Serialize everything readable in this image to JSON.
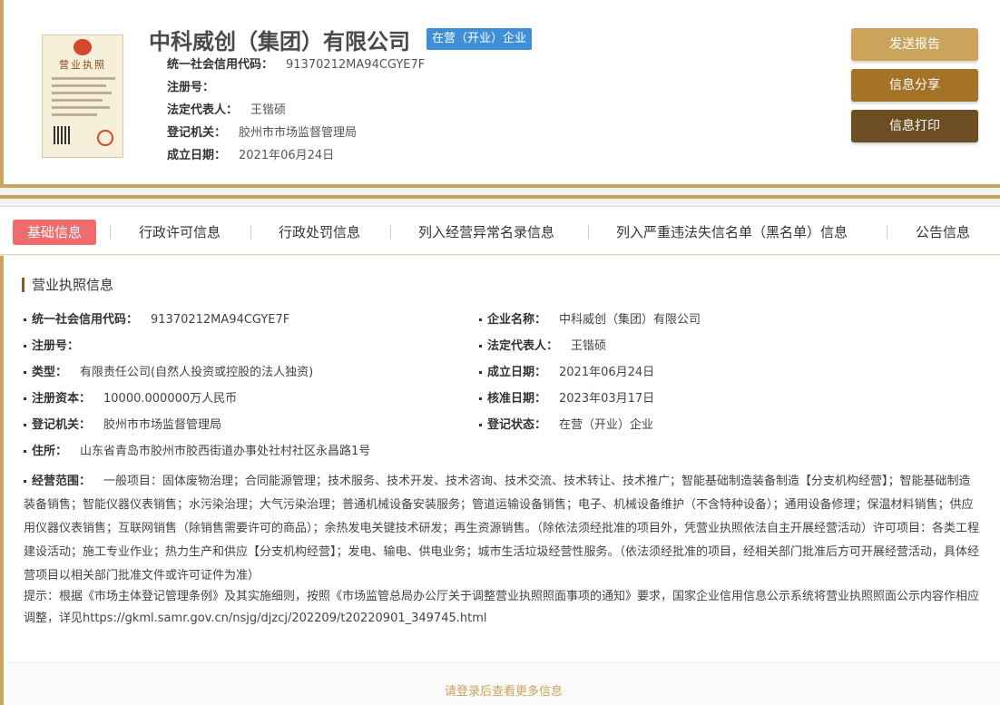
{
  "header": {
    "company_name": "中科威创（集团）有限公司",
    "status": "在营（开业）企业",
    "info": [
      {
        "label": "统一社会信用代码：",
        "value": "91370212MA94CGYE7F"
      },
      {
        "label": "注册号：",
        "value": ""
      },
      {
        "label": "法定代表人：",
        "value": "王锴硕"
      },
      {
        "label": "登记机关：",
        "value": "胶州市市场监督管理局"
      },
      {
        "label": "成立日期：",
        "value": "2021年06月24日"
      }
    ],
    "license": {
      "title": "营业执照"
    },
    "buttons": {
      "send": "发送报告",
      "share": "信息分享",
      "print": "信息打印"
    }
  },
  "tabs": [
    "基础信息",
    "行政许可信息",
    "行政处罚信息",
    "列入经营异常名录信息",
    "列入严重违法失信名单（黑名单）信息",
    "公告信息"
  ],
  "section": {
    "title": "营业执照信息"
  },
  "fields": {
    "credit_code": {
      "label": "统一社会信用代码：",
      "value": "91370212MA94CGYE7F"
    },
    "company_name": {
      "label": "企业名称：",
      "value": "中科威创（集团）有限公司"
    },
    "reg_no": {
      "label": "注册号：",
      "value": ""
    },
    "legal_rep": {
      "label": "法定代表人：",
      "value": "王锴硕"
    },
    "type": {
      "label": "类型：",
      "value": "有限责任公司(自然人投资或控股的法人独资)"
    },
    "est_date": {
      "label": "成立日期：",
      "value": "2021年06月24日"
    },
    "capital": {
      "label": "注册资本：",
      "value": "10000.000000万人民币"
    },
    "approve_date": {
      "label": "核准日期：",
      "value": "2023年03月17日"
    },
    "authority": {
      "label": "登记机关：",
      "value": "胶州市市场监督管理局"
    },
    "reg_status": {
      "label": "登记状态：",
      "value": "在营（开业）企业"
    },
    "address": {
      "label": "住所：",
      "value": "山东省青岛市胶州市胶西街道办事处社村社区永昌路1号"
    }
  },
  "scope": {
    "label": "经营范围：",
    "value": "一般项目：固体废物治理；合同能源管理；技术服务、技术开发、技术咨询、技术交流、技术转让、技术推广；智能基础制造装备制造【分支机构经营】；智能基础制造装备销售；智能仪器仪表销售；水污染治理；大气污染治理；普通机械设备安装服务；管道运输设备销售；电子、机械设备维护（不含特种设备）；通用设备修理；保温材料销售；供应用仪器仪表销售；互联网销售（除销售需要许可的商品）；余热发电关键技术研发；再生资源销售。（除依法须经批准的项目外，凭营业执照依法自主开展经营活动）许可项目：各类工程建设活动；施工专业作业；热力生产和供应【分支机构经营】；发电、输电、供电业务；城市生活垃圾经营性服务。（依法须经批准的项目，经相关部门批准后方可开展经营活动，具体经营项目以相关部门批准文件或许可证件为准）"
  },
  "tip": "提示：根据《市场主体登记管理条例》及其实施细则，按照《市场监管总局办公厅关于调整营业执照照面事项的通知》要求，国家企业信用信息公示系统将营业执照照面公示内容作相应调整，详见https://gkml.samr.gov.cn/nsjg/djzcj/202209/t20220901_349745.html",
  "login_more": "请登录后查看更多信息"
}
